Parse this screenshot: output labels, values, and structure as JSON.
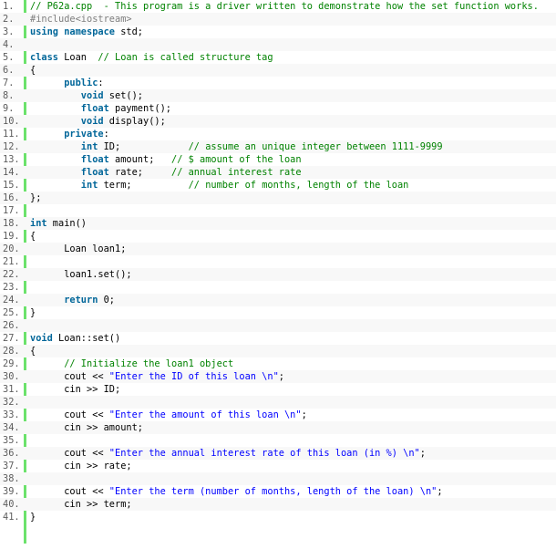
{
  "colors": {
    "keyword": "#006699",
    "comment": "#008200",
    "string": "#0000ff",
    "preprocessor": "#808080",
    "gutter_bar": "#6ce26c",
    "line_number": "#5c5c5c",
    "alt_row": "#f8f8f8"
  },
  "lines": [
    {
      "num": "1.",
      "tokens": [
        {
          "c": "cm",
          "t": "// P62a.cpp  - This program is a driver written to demonstrate how the set function works."
        }
      ]
    },
    {
      "num": "2.",
      "tokens": [
        {
          "c": "pp",
          "t": "#include<iostream>"
        }
      ]
    },
    {
      "num": "3.",
      "tokens": [
        {
          "c": "kw",
          "t": "using"
        },
        {
          "c": "nm",
          "t": " "
        },
        {
          "c": "kw",
          "t": "namespace"
        },
        {
          "c": "nm",
          "t": " std;"
        }
      ]
    },
    {
      "num": "4.",
      "tokens": []
    },
    {
      "num": "5.",
      "tokens": [
        {
          "c": "kw",
          "t": "class"
        },
        {
          "c": "nm",
          "t": " Loan  "
        },
        {
          "c": "cm",
          "t": "// Loan is called structure tag"
        }
      ]
    },
    {
      "num": "6.",
      "tokens": [
        {
          "c": "nm",
          "t": "{"
        }
      ]
    },
    {
      "num": "7.",
      "tokens": [
        {
          "c": "nm",
          "t": "      "
        },
        {
          "c": "kw",
          "t": "public"
        },
        {
          "c": "nm",
          "t": ":"
        }
      ]
    },
    {
      "num": "8.",
      "tokens": [
        {
          "c": "nm",
          "t": "         "
        },
        {
          "c": "kw",
          "t": "void"
        },
        {
          "c": "nm",
          "t": " set();"
        }
      ]
    },
    {
      "num": "9.",
      "tokens": [
        {
          "c": "nm",
          "t": "         "
        },
        {
          "c": "kw",
          "t": "float"
        },
        {
          "c": "nm",
          "t": " payment();"
        }
      ]
    },
    {
      "num": "10.",
      "tokens": [
        {
          "c": "nm",
          "t": "         "
        },
        {
          "c": "kw",
          "t": "void"
        },
        {
          "c": "nm",
          "t": " display();"
        }
      ]
    },
    {
      "num": "11.",
      "tokens": [
        {
          "c": "nm",
          "t": "      "
        },
        {
          "c": "kw",
          "t": "private"
        },
        {
          "c": "nm",
          "t": ":"
        }
      ]
    },
    {
      "num": "12.",
      "tokens": [
        {
          "c": "nm",
          "t": "         "
        },
        {
          "c": "kw",
          "t": "int"
        },
        {
          "c": "nm",
          "t": " ID;            "
        },
        {
          "c": "cm",
          "t": "// assume an unique integer between 1111-9999"
        }
      ]
    },
    {
      "num": "13.",
      "tokens": [
        {
          "c": "nm",
          "t": "         "
        },
        {
          "c": "kw",
          "t": "float"
        },
        {
          "c": "nm",
          "t": " amount;   "
        },
        {
          "c": "cm",
          "t": "// $ amount of the loan"
        }
      ]
    },
    {
      "num": "14.",
      "tokens": [
        {
          "c": "nm",
          "t": "         "
        },
        {
          "c": "kw",
          "t": "float"
        },
        {
          "c": "nm",
          "t": " rate;     "
        },
        {
          "c": "cm",
          "t": "// annual interest rate"
        }
      ]
    },
    {
      "num": "15.",
      "tokens": [
        {
          "c": "nm",
          "t": "         "
        },
        {
          "c": "kw",
          "t": "int"
        },
        {
          "c": "nm",
          "t": " term;          "
        },
        {
          "c": "cm",
          "t": "// number of months, length of the loan"
        }
      ]
    },
    {
      "num": "16.",
      "tokens": [
        {
          "c": "nm",
          "t": "};"
        }
      ]
    },
    {
      "num": "17.",
      "tokens": []
    },
    {
      "num": "18.",
      "tokens": [
        {
          "c": "kw",
          "t": "int"
        },
        {
          "c": "nm",
          "t": " main()"
        }
      ]
    },
    {
      "num": "19.",
      "tokens": [
        {
          "c": "nm",
          "t": "{"
        }
      ]
    },
    {
      "num": "20.",
      "tokens": [
        {
          "c": "nm",
          "t": "      Loan loan1;"
        }
      ]
    },
    {
      "num": "21.",
      "tokens": []
    },
    {
      "num": "22.",
      "tokens": [
        {
          "c": "nm",
          "t": "      loan1.set();"
        }
      ]
    },
    {
      "num": "23.",
      "tokens": []
    },
    {
      "num": "24.",
      "tokens": [
        {
          "c": "nm",
          "t": "      "
        },
        {
          "c": "kw",
          "t": "return"
        },
        {
          "c": "nm",
          "t": " 0;"
        }
      ]
    },
    {
      "num": "25.",
      "tokens": [
        {
          "c": "nm",
          "t": "}"
        }
      ]
    },
    {
      "num": "26.",
      "tokens": []
    },
    {
      "num": "27.",
      "tokens": [
        {
          "c": "kw",
          "t": "void"
        },
        {
          "c": "nm",
          "t": " Loan::set()"
        }
      ]
    },
    {
      "num": "28.",
      "tokens": [
        {
          "c": "nm",
          "t": "{"
        }
      ]
    },
    {
      "num": "29.",
      "tokens": [
        {
          "c": "nm",
          "t": "      "
        },
        {
          "c": "cm",
          "t": "// Initialize the loan1 object"
        }
      ]
    },
    {
      "num": "30.",
      "tokens": [
        {
          "c": "nm",
          "t": "      cout << "
        },
        {
          "c": "st",
          "t": "\"Enter the ID of this loan \\n\""
        },
        {
          "c": "nm",
          "t": ";"
        }
      ]
    },
    {
      "num": "31.",
      "tokens": [
        {
          "c": "nm",
          "t": "      cin >> ID;"
        }
      ]
    },
    {
      "num": "32.",
      "tokens": []
    },
    {
      "num": "33.",
      "tokens": [
        {
          "c": "nm",
          "t": "      cout << "
        },
        {
          "c": "st",
          "t": "\"Enter the amount of this loan \\n\""
        },
        {
          "c": "nm",
          "t": ";"
        }
      ]
    },
    {
      "num": "34.",
      "tokens": [
        {
          "c": "nm",
          "t": "      cin >> amount;"
        }
      ]
    },
    {
      "num": "35.",
      "tokens": []
    },
    {
      "num": "36.",
      "tokens": [
        {
          "c": "nm",
          "t": "      cout << "
        },
        {
          "c": "st",
          "t": "\"Enter the annual interest rate of this loan (in %) \\n\""
        },
        {
          "c": "nm",
          "t": ";"
        }
      ]
    },
    {
      "num": "37.",
      "tokens": [
        {
          "c": "nm",
          "t": "      cin >> rate;"
        }
      ]
    },
    {
      "num": "38.",
      "tokens": []
    },
    {
      "num": "39.",
      "tokens": [
        {
          "c": "nm",
          "t": "      cout << "
        },
        {
          "c": "st",
          "t": "\"Enter the term (number of months, length of the loan) \\n\""
        },
        {
          "c": "nm",
          "t": ";"
        }
      ]
    },
    {
      "num": "40.",
      "tokens": [
        {
          "c": "nm",
          "t": "      cin >> term;"
        }
      ]
    },
    {
      "num": "41.",
      "tokens": [
        {
          "c": "nm",
          "t": "}"
        }
      ]
    }
  ]
}
